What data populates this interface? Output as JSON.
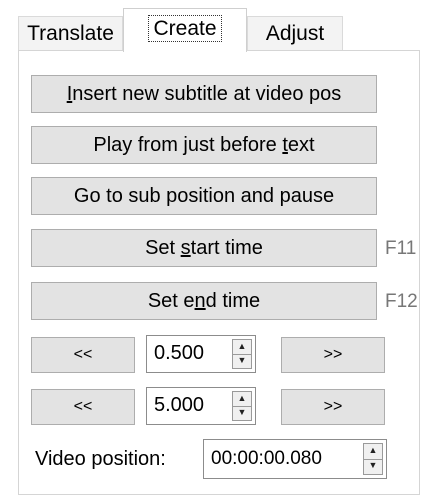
{
  "tabs": [
    {
      "label": "Translate"
    },
    {
      "label": "Create"
    },
    {
      "label": "Adjust"
    }
  ],
  "buttons": {
    "insert_subtitle": {
      "u": "I",
      "rest": "nsert new subtitle at video pos"
    },
    "play_before": {
      "pre": "Play from just before ",
      "u": "t",
      "post": "ext"
    },
    "go_to_sub": {
      "label": "Go to sub position and pause"
    },
    "set_start": {
      "pre": "Set ",
      "u": "s",
      "post": "tart time"
    },
    "set_end": {
      "pre": "Set e",
      "u": "n",
      "post": "d time"
    }
  },
  "shortcuts": {
    "set_start": "F11",
    "set_end": "F12"
  },
  "row1": {
    "back": "<<",
    "value": "0.500",
    "forward": ">>"
  },
  "row2": {
    "back": "<<",
    "value": "5.000",
    "forward": ">>"
  },
  "video_position": {
    "label": "Video position:",
    "value": "00:00:00.080"
  },
  "icons": {
    "spin_up": "spin-up-icon",
    "spin_down": "spin-down-icon"
  }
}
